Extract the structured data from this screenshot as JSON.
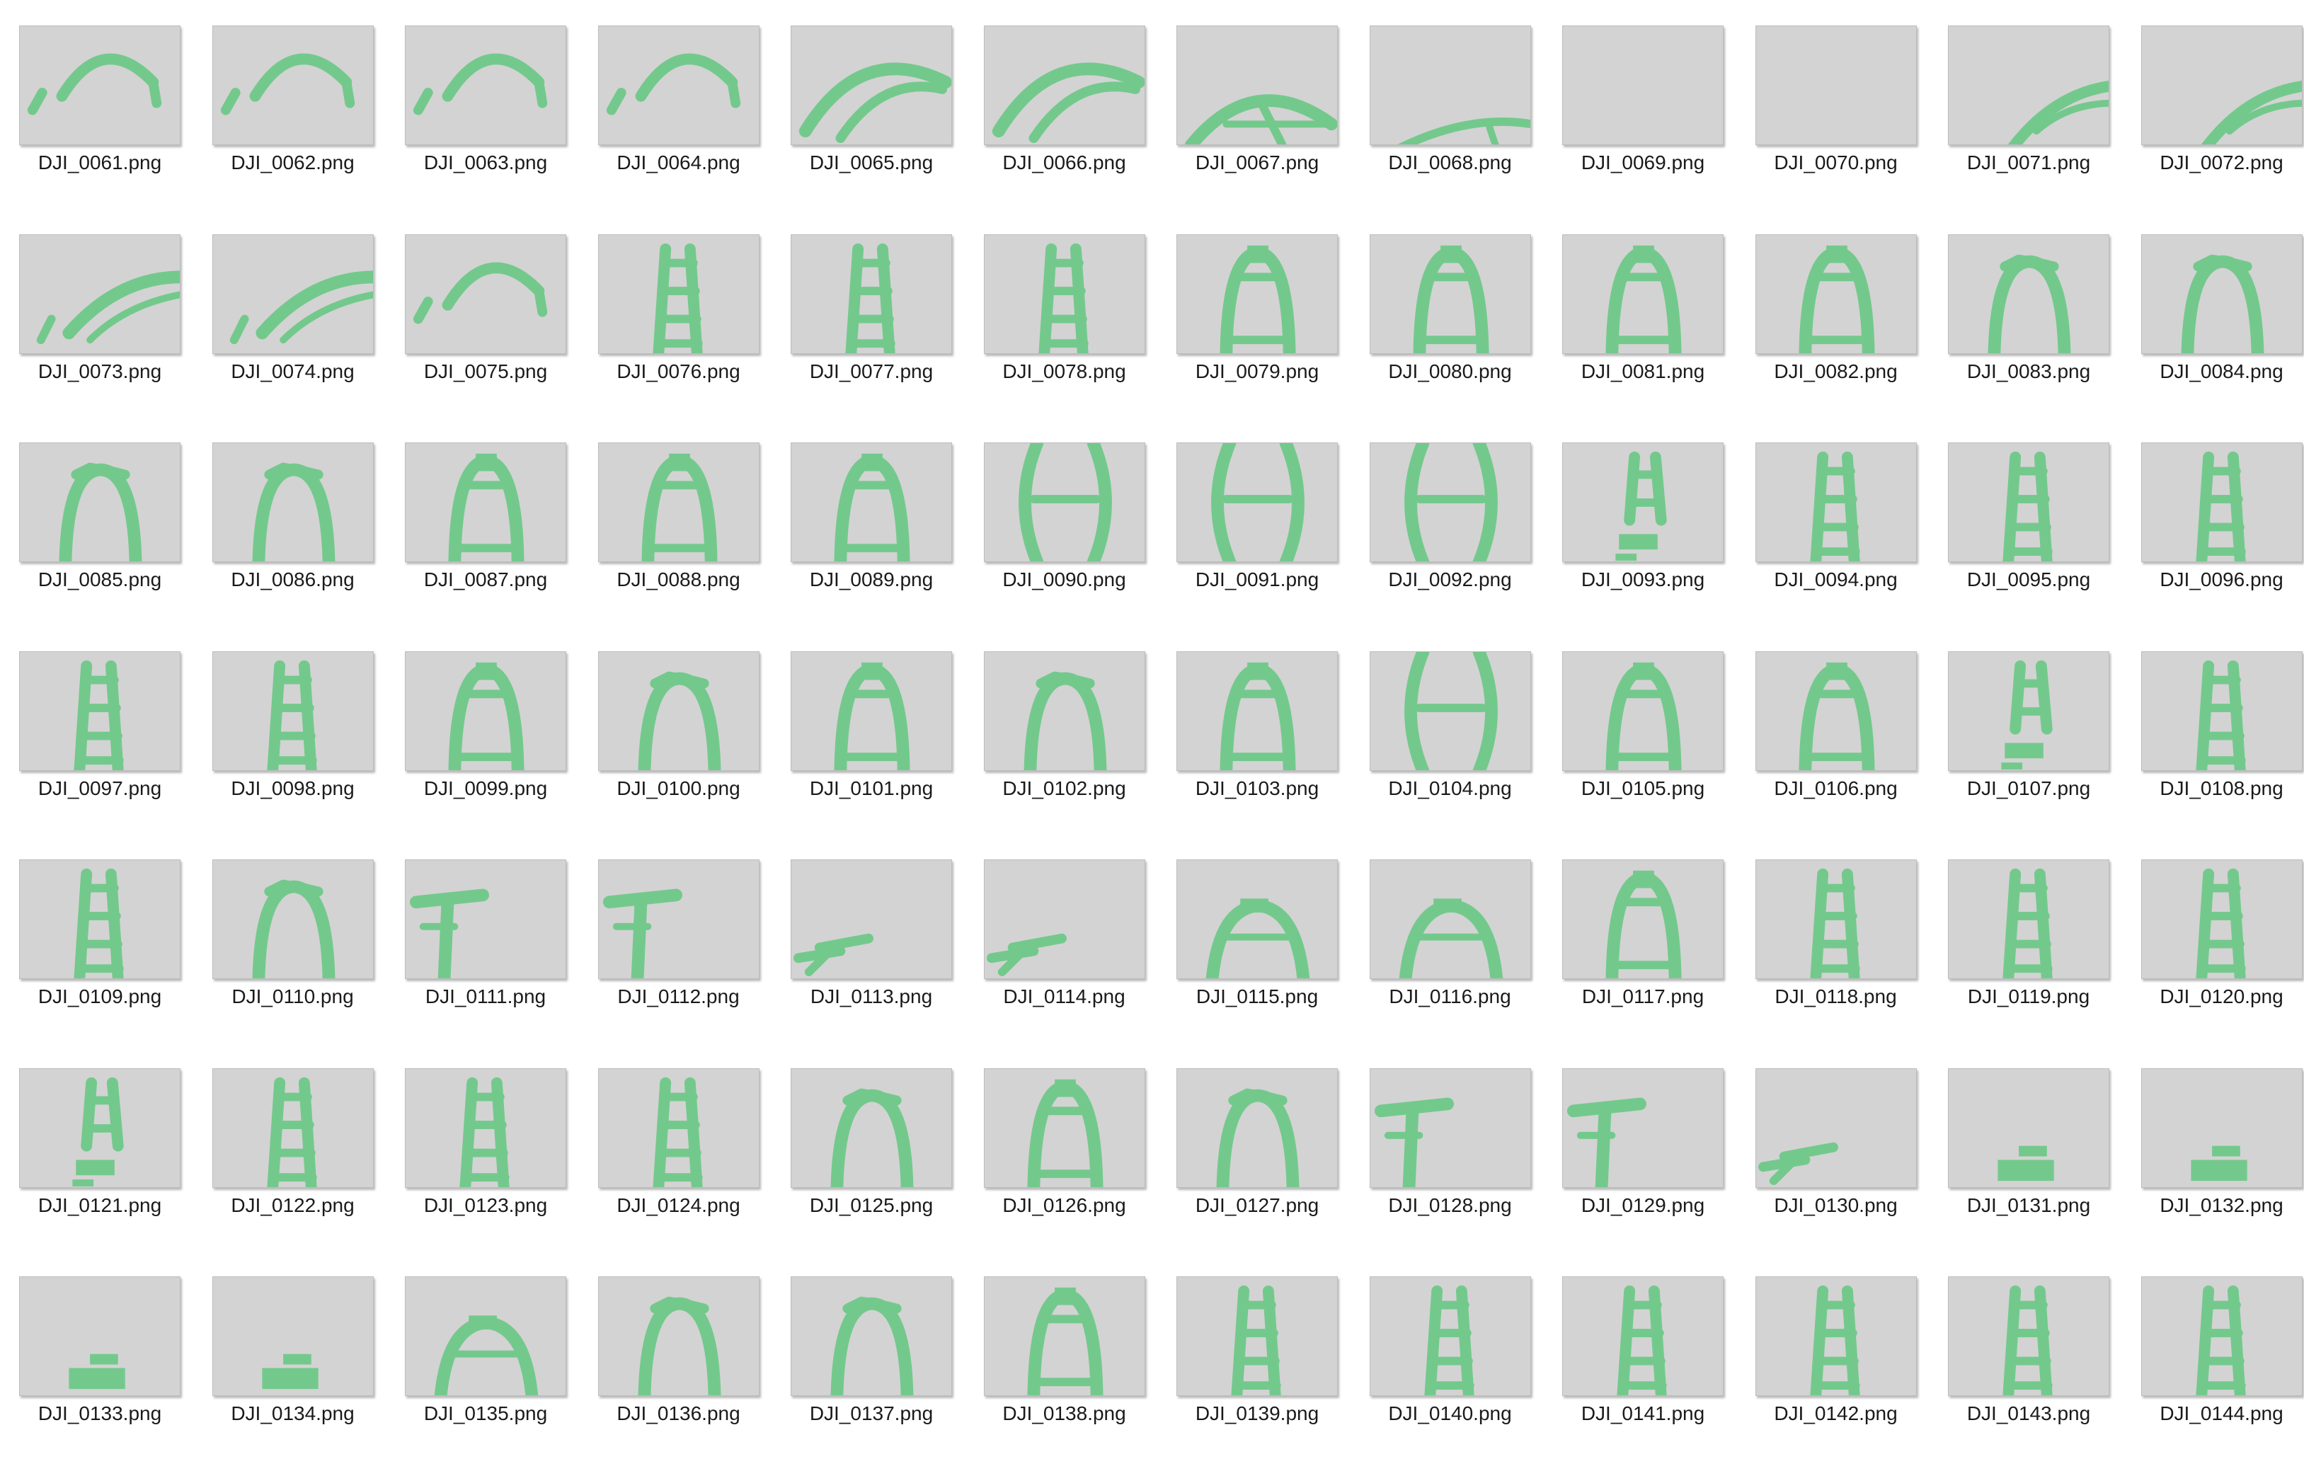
{
  "window": {
    "view": "large-icons",
    "background_color": "#ffffff",
    "thumbnail_background": "#d3d3d3",
    "mask_color": "#73c98c"
  },
  "files": [
    {
      "name": "DJI_0061.png",
      "thumb": "arc-left"
    },
    {
      "name": "DJI_0062.png",
      "thumb": "arc-left"
    },
    {
      "name": "DJI_0063.png",
      "thumb": "arc-left"
    },
    {
      "name": "DJI_0064.png",
      "thumb": "arc-left"
    },
    {
      "name": "DJI_0065.png",
      "thumb": "arc-double"
    },
    {
      "name": "DJI_0066.png",
      "thumb": "arc-double"
    },
    {
      "name": "DJI_0067.png",
      "thumb": "arc-low"
    },
    {
      "name": "DJI_0068.png",
      "thumb": "arc-bottom"
    },
    {
      "name": "DJI_0069.png",
      "thumb": "empty"
    },
    {
      "name": "DJI_0070.png",
      "thumb": "empty"
    },
    {
      "name": "DJI_0071.png",
      "thumb": "arc-corner"
    },
    {
      "name": "DJI_0072.png",
      "thumb": "arc-corner"
    },
    {
      "name": "DJI_0073.png",
      "thumb": "arc-right"
    },
    {
      "name": "DJI_0074.png",
      "thumb": "arc-right"
    },
    {
      "name": "DJI_0075.png",
      "thumb": "arc-left"
    },
    {
      "name": "DJI_0076.png",
      "thumb": "ladder"
    },
    {
      "name": "DJI_0077.png",
      "thumb": "ladder"
    },
    {
      "name": "DJI_0078.png",
      "thumb": "ladder"
    },
    {
      "name": "DJI_0079.png",
      "thumb": "frame"
    },
    {
      "name": "DJI_0080.png",
      "thumb": "frame"
    },
    {
      "name": "DJI_0081.png",
      "thumb": "frame"
    },
    {
      "name": "DJI_0082.png",
      "thumb": "frame"
    },
    {
      "name": "DJI_0083.png",
      "thumb": "arch"
    },
    {
      "name": "DJI_0084.png",
      "thumb": "arch"
    },
    {
      "name": "DJI_0085.png",
      "thumb": "arch"
    },
    {
      "name": "DJI_0086.png",
      "thumb": "arch"
    },
    {
      "name": "DJI_0087.png",
      "thumb": "frame"
    },
    {
      "name": "DJI_0088.png",
      "thumb": "frame"
    },
    {
      "name": "DJI_0089.png",
      "thumb": "frame"
    },
    {
      "name": "DJI_0090.png",
      "thumb": "barrel"
    },
    {
      "name": "DJI_0091.png",
      "thumb": "barrel"
    },
    {
      "name": "DJI_0092.png",
      "thumb": "barrel"
    },
    {
      "name": "DJI_0093.png",
      "thumb": "ladder-broken"
    },
    {
      "name": "DJI_0094.png",
      "thumb": "ladder"
    },
    {
      "name": "DJI_0095.png",
      "thumb": "ladder"
    },
    {
      "name": "DJI_0096.png",
      "thumb": "ladder"
    },
    {
      "name": "DJI_0097.png",
      "thumb": "ladder"
    },
    {
      "name": "DJI_0098.png",
      "thumb": "ladder"
    },
    {
      "name": "DJI_0099.png",
      "thumb": "frame"
    },
    {
      "name": "DJI_0100.png",
      "thumb": "arch"
    },
    {
      "name": "DJI_0101.png",
      "thumb": "frame"
    },
    {
      "name": "DJI_0102.png",
      "thumb": "arch"
    },
    {
      "name": "DJI_0103.png",
      "thumb": "frame"
    },
    {
      "name": "DJI_0104.png",
      "thumb": "barrel"
    },
    {
      "name": "DJI_0105.png",
      "thumb": "frame"
    },
    {
      "name": "DJI_0106.png",
      "thumb": "frame"
    },
    {
      "name": "DJI_0107.png",
      "thumb": "ladder-broken"
    },
    {
      "name": "DJI_0108.png",
      "thumb": "ladder"
    },
    {
      "name": "DJI_0109.png",
      "thumb": "ladder"
    },
    {
      "name": "DJI_0110.png",
      "thumb": "arch"
    },
    {
      "name": "DJI_0111.png",
      "thumb": "tee"
    },
    {
      "name": "DJI_0112.png",
      "thumb": "tee"
    },
    {
      "name": "DJI_0113.png",
      "thumb": "bars"
    },
    {
      "name": "DJI_0114.png",
      "thumb": "bars"
    },
    {
      "name": "DJI_0115.png",
      "thumb": "arch-low"
    },
    {
      "name": "DJI_0116.png",
      "thumb": "arch-low"
    },
    {
      "name": "DJI_0117.png",
      "thumb": "frame"
    },
    {
      "name": "DJI_0118.png",
      "thumb": "ladder"
    },
    {
      "name": "DJI_0119.png",
      "thumb": "ladder"
    },
    {
      "name": "DJI_0120.png",
      "thumb": "ladder"
    },
    {
      "name": "DJI_0121.png",
      "thumb": "ladder-broken"
    },
    {
      "name": "DJI_0122.png",
      "thumb": "ladder"
    },
    {
      "name": "DJI_0123.png",
      "thumb": "ladder"
    },
    {
      "name": "DJI_0124.png",
      "thumb": "ladder"
    },
    {
      "name": "DJI_0125.png",
      "thumb": "arch"
    },
    {
      "name": "DJI_0126.png",
      "thumb": "frame"
    },
    {
      "name": "DJI_0127.png",
      "thumb": "arch"
    },
    {
      "name": "DJI_0128.png",
      "thumb": "tee"
    },
    {
      "name": "DJI_0129.png",
      "thumb": "tee"
    },
    {
      "name": "DJI_0130.png",
      "thumb": "bars"
    },
    {
      "name": "DJI_0131.png",
      "thumb": "block"
    },
    {
      "name": "DJI_0132.png",
      "thumb": "block"
    },
    {
      "name": "DJI_0133.png",
      "thumb": "block"
    },
    {
      "name": "DJI_0134.png",
      "thumb": "block"
    },
    {
      "name": "DJI_0135.png",
      "thumb": "arch-low"
    },
    {
      "name": "DJI_0136.png",
      "thumb": "arch"
    },
    {
      "name": "DJI_0137.png",
      "thumb": "arch"
    },
    {
      "name": "DJI_0138.png",
      "thumb": "frame"
    },
    {
      "name": "DJI_0139.png",
      "thumb": "ladder"
    },
    {
      "name": "DJI_0140.png",
      "thumb": "ladder"
    },
    {
      "name": "DJI_0141.png",
      "thumb": "ladder"
    },
    {
      "name": "DJI_0142.png",
      "thumb": "ladder"
    },
    {
      "name": "DJI_0143.png",
      "thumb": "ladder"
    },
    {
      "name": "DJI_0144.png",
      "thumb": "ladder"
    }
  ]
}
